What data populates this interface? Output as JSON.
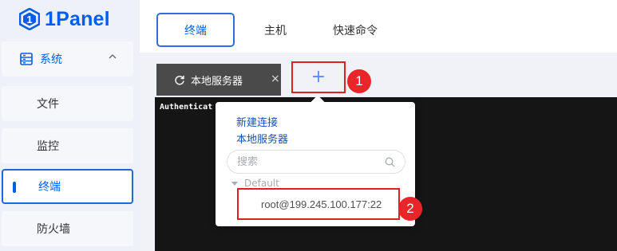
{
  "brand": {
    "name": "1Panel",
    "color": "#005eeb"
  },
  "sidebar": {
    "group": {
      "label": "系统",
      "icon": "server-icon",
      "expanded": true
    },
    "items": [
      {
        "label": "文件",
        "active": false
      },
      {
        "label": "监控",
        "active": false
      },
      {
        "label": "终端",
        "active": true
      },
      {
        "label": "防火墙",
        "active": false
      }
    ]
  },
  "tabs": [
    {
      "label": "终端",
      "active": true
    },
    {
      "label": "主机",
      "active": false
    },
    {
      "label": "快速命令",
      "active": false
    }
  ],
  "session_tab": {
    "label": "本地服务器",
    "icon": "refresh-icon",
    "close": "×"
  },
  "add_button": {
    "label": "+"
  },
  "annotations": [
    "1",
    "2"
  ],
  "terminal": {
    "text": "Authenticat                                        ormation!"
  },
  "popover": {
    "links": [
      "新建连接",
      "本地服务器"
    ],
    "search": {
      "placeholder": "搜索",
      "value": ""
    },
    "tree": {
      "group": "Default",
      "hosts": [
        "root@199.245.100.177:22"
      ]
    }
  },
  "colors": {
    "accent": "#005eeb",
    "highlight": "#e02020",
    "terminal_bg": "#151515"
  }
}
